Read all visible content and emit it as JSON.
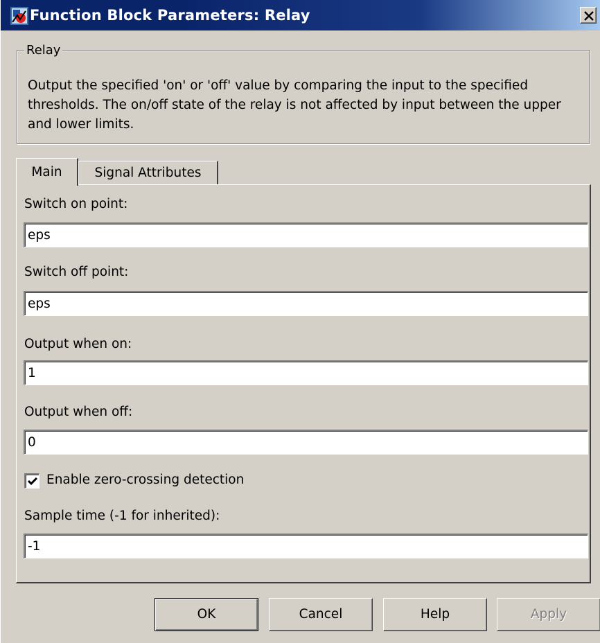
{
  "window": {
    "title": "Function Block Parameters: Relay",
    "close_glyph": "✕"
  },
  "group": {
    "legend": "Relay",
    "description": "Output the specified 'on' or 'off' value by comparing the input to the specified thresholds.  The on/off state of the relay is not affected by input between the upper and lower limits."
  },
  "tabs": [
    {
      "label": "Main",
      "active": true
    },
    {
      "label": "Signal Attributes",
      "active": false
    }
  ],
  "fields": {
    "switch_on": {
      "label": "Switch on point:",
      "value": "eps"
    },
    "switch_off": {
      "label": "Switch off point:",
      "value": "eps"
    },
    "output_on": {
      "label": "Output when on:",
      "value": "1"
    },
    "output_off": {
      "label": "Output when off:",
      "value": "0"
    },
    "zero_crossing": {
      "label": "Enable zero-crossing detection",
      "checked": true
    },
    "sample_time": {
      "label": "Sample time (-1 for inherited):",
      "value": "-1"
    }
  },
  "buttons": {
    "ok": "OK",
    "cancel": "Cancel",
    "help": "Help",
    "apply": "Apply"
  },
  "colors": {
    "titlebar_start": "#0a246a",
    "titlebar_end": "#a6caf0",
    "dialog_face": "#d4d0c8",
    "disabled_text": "#808080"
  },
  "icons": {
    "app": "simulink-block-icon",
    "close": "close-icon",
    "check": "checkmark-icon"
  }
}
